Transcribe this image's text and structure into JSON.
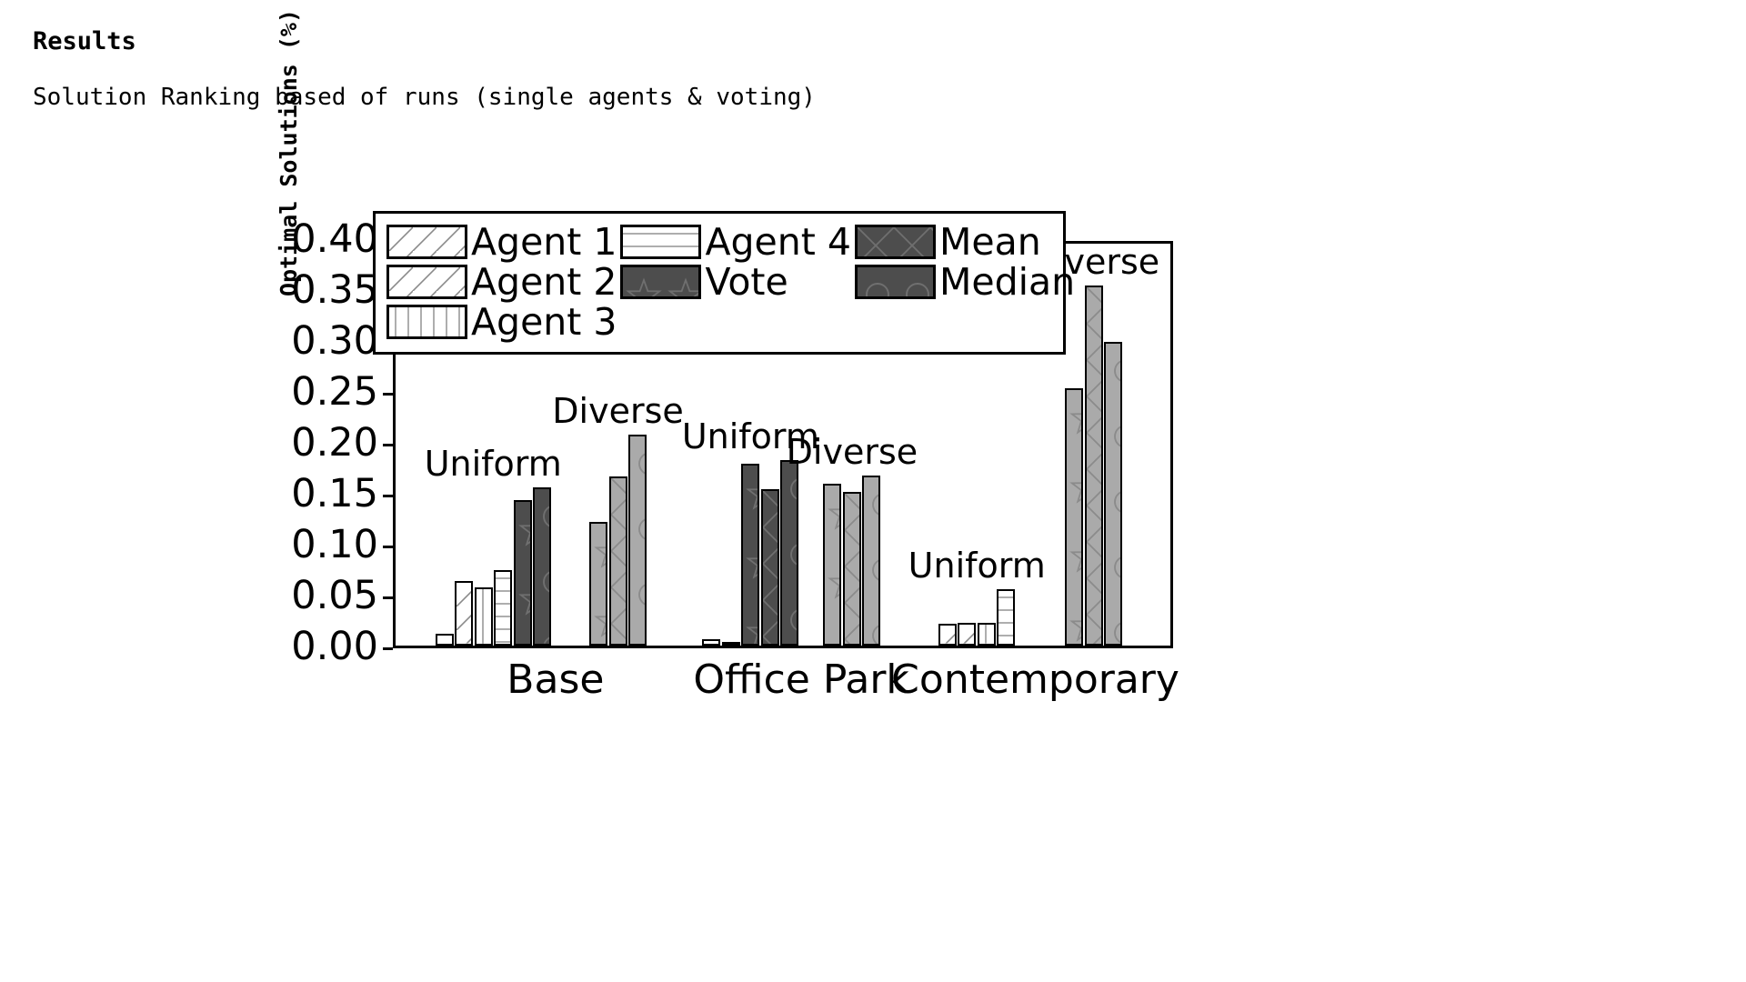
{
  "slide": {
    "title": "Results",
    "subtitle": "Solution Ranking based of runs (single agents & voting)"
  },
  "chart_data": {
    "type": "bar",
    "title": "",
    "xlabel": "",
    "ylabel": "Optimal Solutions (%)",
    "ylim": [
      0.0,
      0.4
    ],
    "ytick_labels": [
      "0.00",
      "0.05",
      "0.10",
      "0.15",
      "0.20",
      "0.25",
      "0.30",
      "0.35",
      "0.40"
    ],
    "ytick_values": [
      0.0,
      0.05,
      0.1,
      0.15,
      0.2,
      0.25,
      0.3,
      0.35,
      0.4
    ],
    "grid": false,
    "legend_position": "upper-left-overlapping-axes",
    "categories": [
      "Base",
      "Office Park",
      "Contemporary"
    ],
    "subgroups": [
      "Uniform",
      "Diverse"
    ],
    "series": [
      {
        "name": "Agent 1",
        "fill": "#ffffff",
        "pattern": "diagonal-hatch",
        "values": [
          0.012,
          0.0,
          0.006,
          0.0,
          0.021,
          0.0
        ]
      },
      {
        "name": "Agent 2",
        "fill": "#ffffff",
        "pattern": "diagonal-hatch",
        "values": [
          0.063,
          0.0,
          0.0,
          0.0,
          0.022,
          0.0
        ]
      },
      {
        "name": "Agent 3",
        "fill": "#ffffff",
        "pattern": "vertical-lines",
        "values": [
          0.057,
          0.0,
          0.003,
          0.0,
          0.022,
          0.0
        ]
      },
      {
        "name": "Agent 4",
        "fill": "#ffffff",
        "pattern": "horizontal-lines",
        "values": [
          0.074,
          0.0,
          0.0,
          0.0,
          0.055,
          0.0
        ]
      },
      {
        "name": "Vote",
        "fill": "#4d4d4d",
        "pattern": "star",
        "values": [
          0.143,
          0.121,
          0.179,
          0.159,
          0.0,
          0.253
        ]
      },
      {
        "name": "Mean",
        "fill": "#4d4d4d",
        "pattern": "crosshatch",
        "values": [
          0.0,
          0.166,
          0.154,
          0.151,
          0.0,
          0.354
        ]
      },
      {
        "name": "Median",
        "fill": "#4d4d4d",
        "pattern": "circles",
        "values": [
          0.155,
          0.207,
          0.182,
          0.167,
          0.0,
          0.298
        ]
      }
    ],
    "annotations": [
      {
        "text": "Uniform",
        "group": "Base",
        "subgroup": "Uniform"
      },
      {
        "text": "Diverse",
        "group": "Base",
        "subgroup": "Diverse"
      },
      {
        "text": "Uniform",
        "group": "Office Park",
        "subgroup": "Uniform"
      },
      {
        "text": "Diverse",
        "group": "Office Park",
        "subgroup": "Diverse"
      },
      {
        "text": "Uniform",
        "group": "Contemporary",
        "subgroup": "Uniform"
      },
      {
        "text": "Diverse",
        "group": "Contemporary",
        "subgroup": "Diverse"
      }
    ]
  },
  "legend": {
    "entries": [
      {
        "label": "Agent 1"
      },
      {
        "label": "Agent 4"
      },
      {
        "label": "Mean"
      },
      {
        "label": "Agent 2"
      },
      {
        "label": "Vote"
      },
      {
        "label": "Median"
      },
      {
        "label": "Agent 3"
      }
    ]
  }
}
